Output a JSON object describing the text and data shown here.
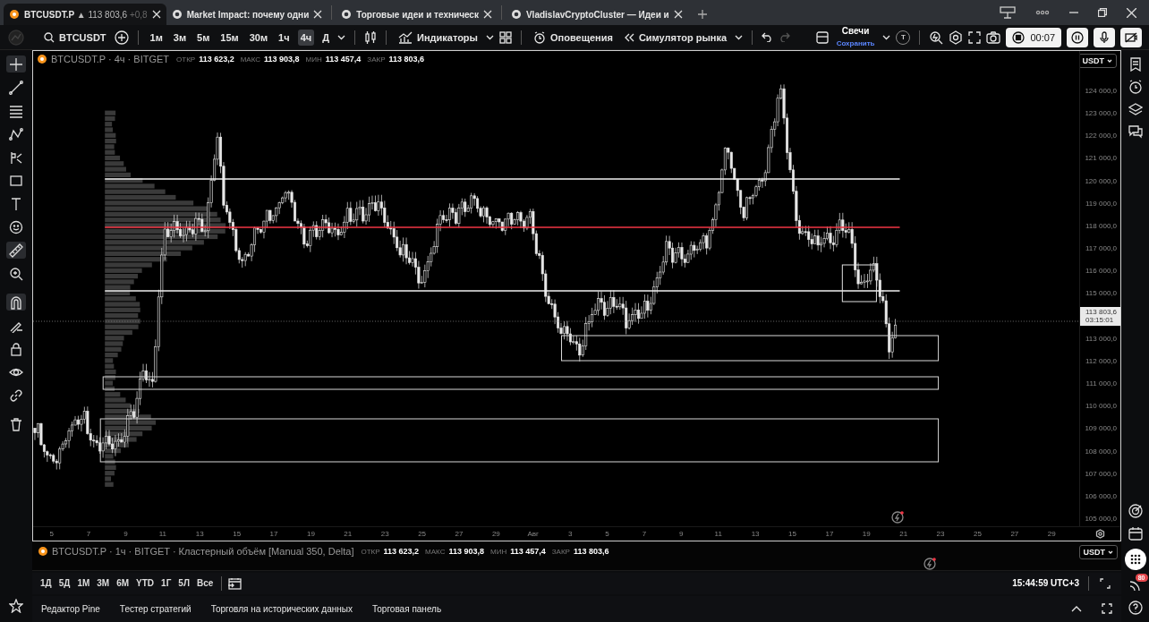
{
  "browser_tabs": [
    {
      "title": "BTCUSDT.P",
      "price": "▲ 113 803,6",
      "change": "+0,8",
      "selected": true
    },
    {
      "title": "Market Impact: почему одни",
      "selected": false
    },
    {
      "title": "Торговые идеи и техническ",
      "selected": false
    },
    {
      "title": "VladislavCryptoCluster — Идеи и",
      "selected": false
    }
  ],
  "toolbar": {
    "symbol": "BTCUSDT",
    "intervals": [
      {
        "label": "1м",
        "selected": false
      },
      {
        "label": "3м",
        "selected": false
      },
      {
        "label": "5м",
        "selected": false
      },
      {
        "label": "15м",
        "selected": false
      },
      {
        "label": "30м",
        "selected": false
      },
      {
        "label": "1ч",
        "selected": false
      },
      {
        "label": "4ч",
        "selected": true
      },
      {
        "label": "Д",
        "selected": false
      }
    ],
    "indicators": "Индикаторы",
    "alerts": "Оповещения",
    "replay": "Симулятор рынка",
    "chart_type": "Свечи",
    "chart_type_note": "Сохранить",
    "profile_letter": "T",
    "recording_time": "00:07"
  },
  "chart": {
    "legend": {
      "title": "BTCUSDT.P · 4ч · BITGET",
      "ohlc": [
        {
          "label": "ОТКР",
          "value": "113 623,2"
        },
        {
          "label": "МАКС",
          "value": "113 903,8"
        },
        {
          "label": "МИН",
          "value": "113 457,4"
        },
        {
          "label": "ЗАКР",
          "value": "113 803,6"
        }
      ]
    },
    "price_axis": {
      "currency": "USDT",
      "ticks_above_price": [
        "124 000,0",
        "123 000,0",
        "122 000,0",
        "121 000,0",
        "120 000,0",
        "119 000,0",
        "118 000,0",
        "117 000,0",
        "116 000,0",
        "115 000,0"
      ],
      "current_price": "113 803,6",
      "countdown": "03:15:01",
      "ticks_below_price": [
        "113 000,0",
        "112 000,0",
        "111 000,0",
        "110 000,0",
        "109 000,0",
        "108 000,0",
        "107 000,0",
        "106 000,0",
        "105 000,0"
      ]
    },
    "time_axis": [
      "5",
      "7",
      "9",
      "11",
      "13",
      "15",
      "17",
      "19",
      "21",
      "23",
      "25",
      "27",
      "29",
      "Авг",
      "3",
      "5",
      "7",
      "9",
      "11",
      "13",
      "15",
      "17",
      "19",
      "21",
      "23",
      "25",
      "27",
      "29"
    ]
  },
  "indicator_pane": {
    "legend": {
      "title": "BTCUSDT.P · 1ч · BITGET · Кластерный объём [Manual 350, Delta]",
      "ohlc": [
        {
          "label": "ОТКР",
          "value": "113 623,2"
        },
        {
          "label": "МАКС",
          "value": "113 903,8"
        },
        {
          "label": "МИН",
          "value": "113 457,4"
        },
        {
          "label": "ЗАКР",
          "value": "113 803,6"
        }
      ]
    },
    "currency": "USDT"
  },
  "range_bar": {
    "ranges": [
      "1Д",
      "5Д",
      "1М",
      "3М",
      "6М",
      "YTD",
      "1Г",
      "5Л",
      "Все"
    ],
    "time": "15:44:59 UTC+3"
  },
  "bottom_tabs": [
    "Редактор Pine",
    "Тестер стратегий",
    "Торговля на исторических данных",
    "Торговая панель"
  ],
  "sidebar": {
    "notifications_badge": "80"
  }
}
